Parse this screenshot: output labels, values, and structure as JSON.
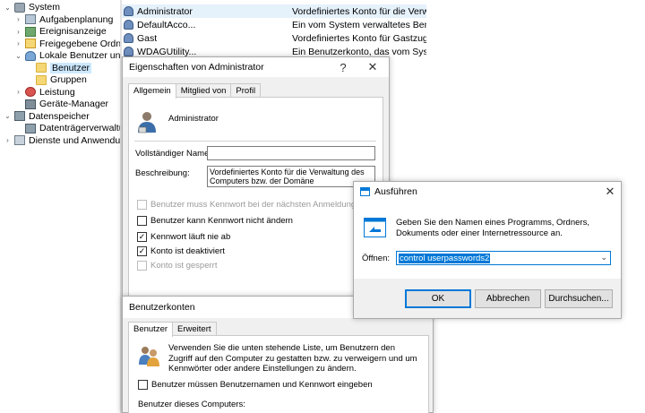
{
  "tree": {
    "items": [
      {
        "label": "System",
        "exp": "⌄",
        "icon": "system-icon",
        "indent": 0
      },
      {
        "label": "Aufgabenplanung",
        "exp": "›",
        "icon": "task-scheduler-icon",
        "indent": 1
      },
      {
        "label": "Ereignisanzeige",
        "exp": "›",
        "icon": "event-viewer-icon",
        "indent": 1
      },
      {
        "label": "Freigegebene Ordner",
        "exp": "›",
        "icon": "shared-folders-icon",
        "indent": 1
      },
      {
        "label": "Lokale Benutzer und Gr",
        "exp": "⌄",
        "icon": "local-users-icon",
        "indent": 1
      },
      {
        "label": "Benutzer",
        "exp": "",
        "icon": "folder-icon",
        "indent": 2,
        "selected": true
      },
      {
        "label": "Gruppen",
        "exp": "",
        "icon": "folder-icon",
        "indent": 2
      },
      {
        "label": "Leistung",
        "exp": "›",
        "icon": "performance-icon",
        "indent": 1
      },
      {
        "label": "Geräte-Manager",
        "exp": "",
        "icon": "device-manager-icon",
        "indent": 1
      },
      {
        "label": "Datenspeicher",
        "exp": "⌄",
        "icon": "storage-icon",
        "indent": 0
      },
      {
        "label": "Datenträgerverwaltung",
        "exp": "",
        "icon": "disk-management-icon",
        "indent": 1
      },
      {
        "label": "Dienste und Anwendungen",
        "exp": "›",
        "icon": "services-icon",
        "indent": 0
      }
    ]
  },
  "users": [
    {
      "name": "Administrator",
      "desc": "Vordefiniertes Konto für die Verwa..."
    },
    {
      "name": "DefaultAcco...",
      "desc": "Ein vom System verwaltetes Benu..."
    },
    {
      "name": "Gast",
      "desc": "Vordefiniertes Konto für Gastzugri..."
    },
    {
      "name": "WDAGUtility...",
      "desc": "Ein Benutzerkonto, das vom Syste..."
    }
  ],
  "props_dialog": {
    "title": "Eigenschaften von Administrator",
    "help": "?",
    "close": "✕",
    "tabs": [
      "Allgemein",
      "Mitglied von",
      "Profil"
    ],
    "account_name": "Administrator",
    "fullname_label": "Vollständiger Name:",
    "fullname_value": "",
    "desc_label": "Beschreibung:",
    "desc_value": "Vordefiniertes Konto für die Verwaltung des Computers bzw. der Domäne",
    "checks": [
      {
        "label": "Benutzer muss Kennwort bei der nächsten Anmeldung ändern",
        "checked": false,
        "disabled": true
      },
      {
        "label": "Benutzer kann Kennwort nicht ändern",
        "checked": false,
        "disabled": false
      },
      {
        "label": "Kennwort läuft nie ab",
        "checked": true,
        "disabled": false
      },
      {
        "label": "Konto ist deaktiviert",
        "checked": true,
        "disabled": false
      },
      {
        "label": "Konto ist gesperrt",
        "checked": false,
        "disabled": true
      }
    ]
  },
  "accounts_dialog": {
    "title": "Benutzerkonten",
    "tabs": [
      "Benutzer",
      "Erweitert"
    ],
    "intro": "Verwenden Sie die unten stehende Liste, um Benutzern den Zugriff auf den Computer zu gestatten bzw. zu verweigern und um Kennwörter oder andere Einstellungen zu ändern.",
    "require_label": "Benutzer müssen Benutzernamen und Kennwort eingeben",
    "users_label": "Benutzer dieses Computers:"
  },
  "run_dialog": {
    "title": "Ausführen",
    "close": "✕",
    "message": "Geben Sie den Namen eines Programms, Ordners, Dokuments oder einer Internetressource an.",
    "open_label": "Öffnen:",
    "open_value": "control userpasswords2",
    "ok": "OK",
    "cancel": "Abbrechen",
    "browse": "Durchsuchen..."
  },
  "colors": {
    "accent": "#0078d7",
    "selection": "#cce8ff"
  }
}
